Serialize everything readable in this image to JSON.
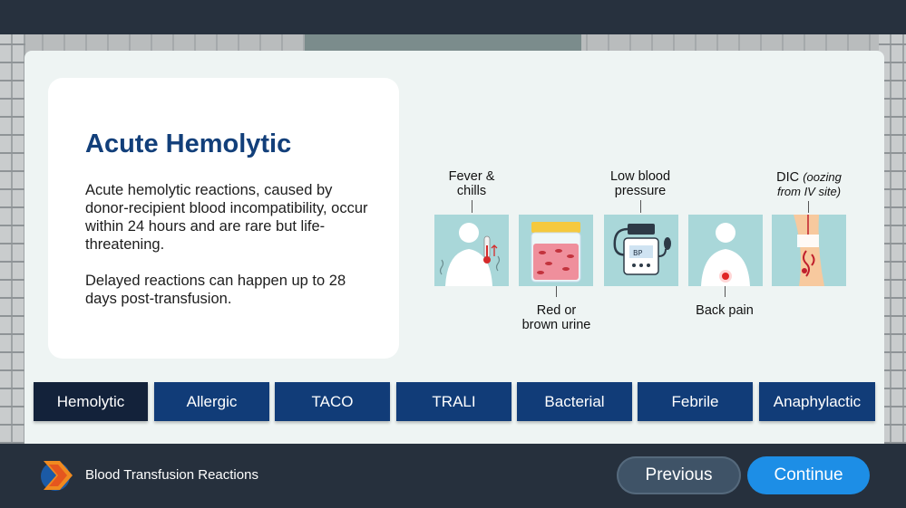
{
  "content": {
    "title": "Acute Hemolytic",
    "paragraph1": "Acute hemolytic reactions, caused by donor-recipient blood incompatibility, occur within 24 hours and are rare but life-threatening.",
    "paragraph2": "Delayed reactions can happen up to 28 days post-transfusion."
  },
  "symptoms": {
    "fever_l1": "Fever &",
    "fever_l2": "chills",
    "urine_l1": "Red or",
    "urine_l2": "brown urine",
    "bp_l1": "Low blood",
    "bp_l2": "pressure",
    "bp_screen": "BP",
    "back": "Back pain",
    "dic_main": "DIC",
    "dic_note_a": "(oozing",
    "dic_note_b": "from IV site)"
  },
  "tabs": [
    {
      "label": "Hemolytic",
      "active": true
    },
    {
      "label": "Allergic"
    },
    {
      "label": "TACO"
    },
    {
      "label": "TRALI"
    },
    {
      "label": "Bacterial"
    },
    {
      "label": "Febrile"
    },
    {
      "label": "Anaphylactic"
    }
  ],
  "footer": {
    "course_title": "Blood Transfusion Reactions",
    "previous_label": "Previous",
    "continue_label": "Continue"
  },
  "colors": {
    "accent": "#1d8ee6",
    "tab": "#113c78",
    "tab_active": "#13223a",
    "title": "#123f7a",
    "icon_bg": "#a9d7d9"
  }
}
